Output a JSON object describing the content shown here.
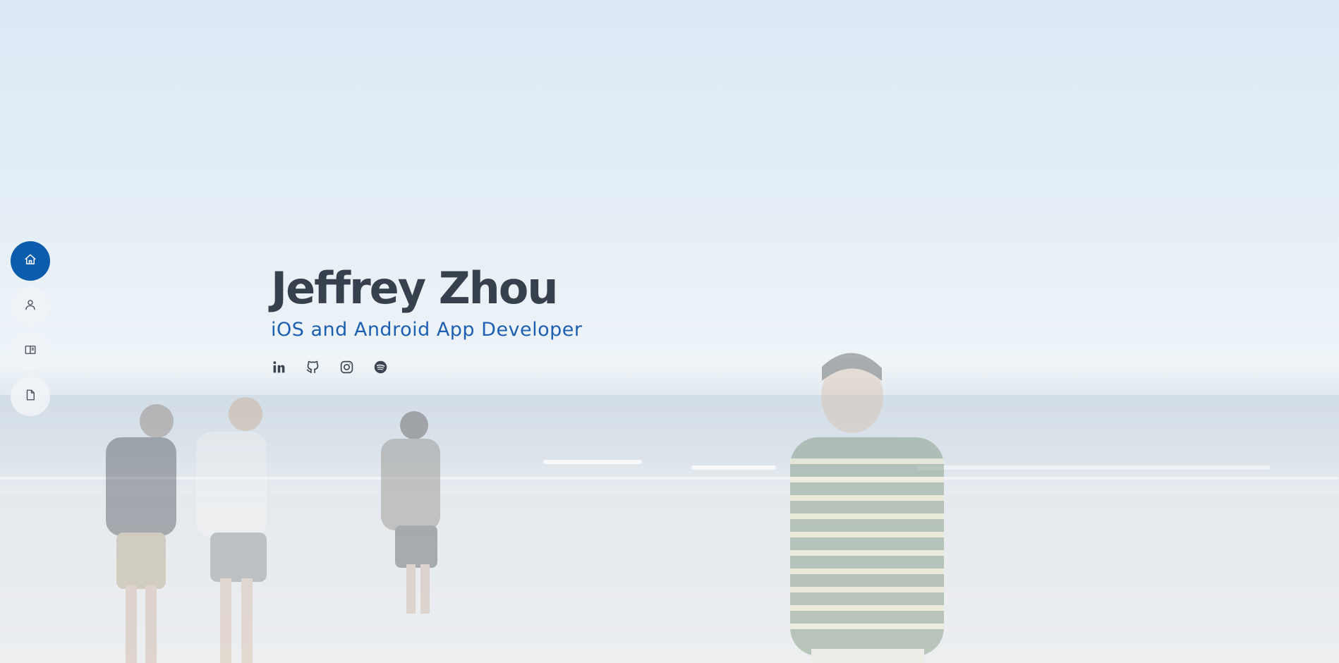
{
  "hero": {
    "name": "Jeffrey Zhou",
    "tagline": "iOS and Android App Developer"
  },
  "side_nav": {
    "items": [
      {
        "icon": "home-icon",
        "active": true
      },
      {
        "icon": "user-icon",
        "active": false
      },
      {
        "icon": "book-icon",
        "active": false
      },
      {
        "icon": "file-icon",
        "active": false
      }
    ]
  },
  "socials": [
    {
      "icon": "linkedin-icon"
    },
    {
      "icon": "github-icon"
    },
    {
      "icon": "instagram-icon"
    },
    {
      "icon": "spotify-icon"
    }
  ],
  "colors": {
    "accent": "#0b5cad",
    "name_text": "#37414d",
    "tagline_text": "#1d5fb0"
  }
}
